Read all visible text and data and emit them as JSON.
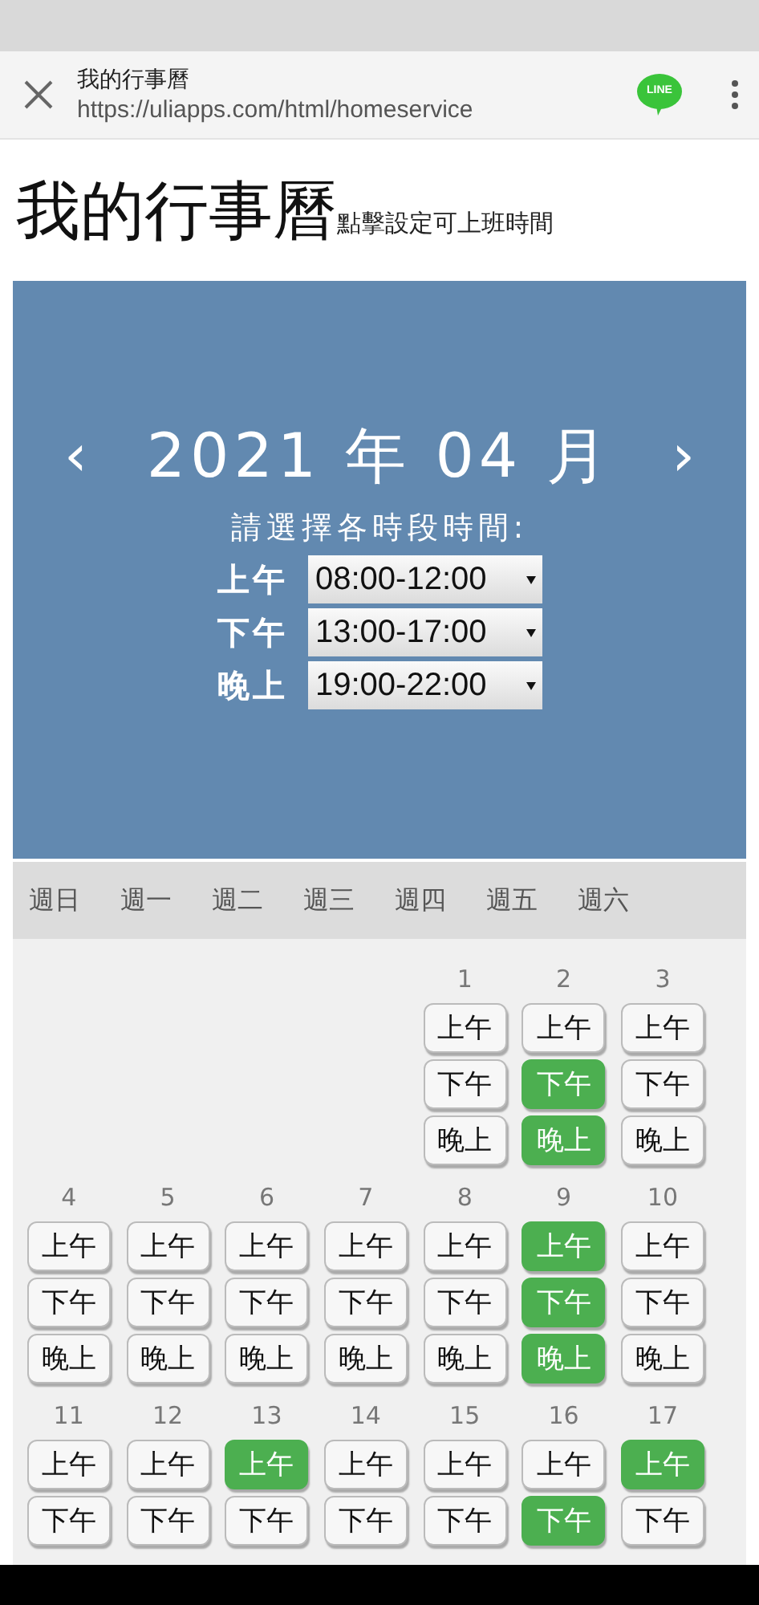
{
  "browser_bar": {
    "title": "我的行事曆",
    "url": "https://uliapps.com/html/homeservice",
    "share_label": "LINE"
  },
  "heading": {
    "title": "我的行事曆",
    "subtitle": "點擊設定可上班時間"
  },
  "month_panel": {
    "prev": "‹",
    "month": "2021 年 04 月",
    "next": "›",
    "prompt": "請選擇各時段時間:",
    "shifts": [
      {
        "label": "上午",
        "value": "08:00-12:00"
      },
      {
        "label": "下午",
        "value": "13:00-17:00"
      },
      {
        "label": "晚上",
        "value": "19:00-22:00"
      }
    ]
  },
  "weekdays": [
    "週日",
    "週一",
    "週二",
    "週三",
    "週四",
    "週五",
    "週六"
  ],
  "weeks": [
    {
      "days": [
        {
          "kind": "blank"
        },
        {
          "kind": "blank"
        },
        {
          "kind": "blank"
        },
        {
          "kind": "blank"
        },
        {
          "kind": "day",
          "date": "1",
          "slots": [
            {
              "label": "上午",
              "selected": false
            },
            {
              "label": "下午",
              "selected": false
            },
            {
              "label": "晚上",
              "selected": false
            }
          ]
        },
        {
          "kind": "day",
          "date": "2",
          "slots": [
            {
              "label": "上午",
              "selected": false
            },
            {
              "label": "下午",
              "selected": true
            },
            {
              "label": "晚上",
              "selected": true
            }
          ]
        },
        {
          "kind": "day",
          "date": "3",
          "slots": [
            {
              "label": "上午",
              "selected": false
            },
            {
              "label": "下午",
              "selected": false
            },
            {
              "label": "晚上",
              "selected": false
            }
          ]
        }
      ]
    },
    {
      "days": [
        {
          "kind": "day",
          "date": "4",
          "slots": [
            {
              "label": "上午",
              "selected": false
            },
            {
              "label": "下午",
              "selected": false
            },
            {
              "label": "晚上",
              "selected": false
            }
          ]
        },
        {
          "kind": "day",
          "date": "5",
          "slots": [
            {
              "label": "上午",
              "selected": false
            },
            {
              "label": "下午",
              "selected": false
            },
            {
              "label": "晚上",
              "selected": false
            }
          ]
        },
        {
          "kind": "day",
          "date": "6",
          "slots": [
            {
              "label": "上午",
              "selected": false
            },
            {
              "label": "下午",
              "selected": false
            },
            {
              "label": "晚上",
              "selected": false
            }
          ]
        },
        {
          "kind": "day",
          "date": "7",
          "slots": [
            {
              "label": "上午",
              "selected": false
            },
            {
              "label": "下午",
              "selected": false
            },
            {
              "label": "晚上",
              "selected": false
            }
          ]
        },
        {
          "kind": "day",
          "date": "8",
          "slots": [
            {
              "label": "上午",
              "selected": false
            },
            {
              "label": "下午",
              "selected": false
            },
            {
              "label": "晚上",
              "selected": false
            }
          ]
        },
        {
          "kind": "day",
          "date": "9",
          "slots": [
            {
              "label": "上午",
              "selected": true
            },
            {
              "label": "下午",
              "selected": true
            },
            {
              "label": "晚上",
              "selected": true
            }
          ]
        },
        {
          "kind": "day",
          "date": "10",
          "slots": [
            {
              "label": "上午",
              "selected": false
            },
            {
              "label": "下午",
              "selected": false
            },
            {
              "label": "晚上",
              "selected": false
            }
          ]
        }
      ]
    },
    {
      "days": [
        {
          "kind": "day",
          "date": "11",
          "slots": [
            {
              "label": "上午",
              "selected": false
            },
            {
              "label": "下午",
              "selected": false
            }
          ]
        },
        {
          "kind": "day",
          "date": "12",
          "slots": [
            {
              "label": "上午",
              "selected": false
            },
            {
              "label": "下午",
              "selected": false
            }
          ]
        },
        {
          "kind": "day",
          "date": "13",
          "slots": [
            {
              "label": "上午",
              "selected": true
            },
            {
              "label": "下午",
              "selected": false
            }
          ]
        },
        {
          "kind": "day",
          "date": "14",
          "slots": [
            {
              "label": "上午",
              "selected": false
            },
            {
              "label": "下午",
              "selected": false
            }
          ]
        },
        {
          "kind": "day",
          "date": "15",
          "slots": [
            {
              "label": "上午",
              "selected": false
            },
            {
              "label": "下午",
              "selected": false
            }
          ]
        },
        {
          "kind": "day",
          "date": "16",
          "slots": [
            {
              "label": "上午",
              "selected": false
            },
            {
              "label": "下午",
              "selected": true
            }
          ]
        },
        {
          "kind": "day",
          "date": "17",
          "slots": [
            {
              "label": "上午",
              "selected": true
            },
            {
              "label": "下午",
              "selected": false
            }
          ]
        }
      ]
    }
  ]
}
